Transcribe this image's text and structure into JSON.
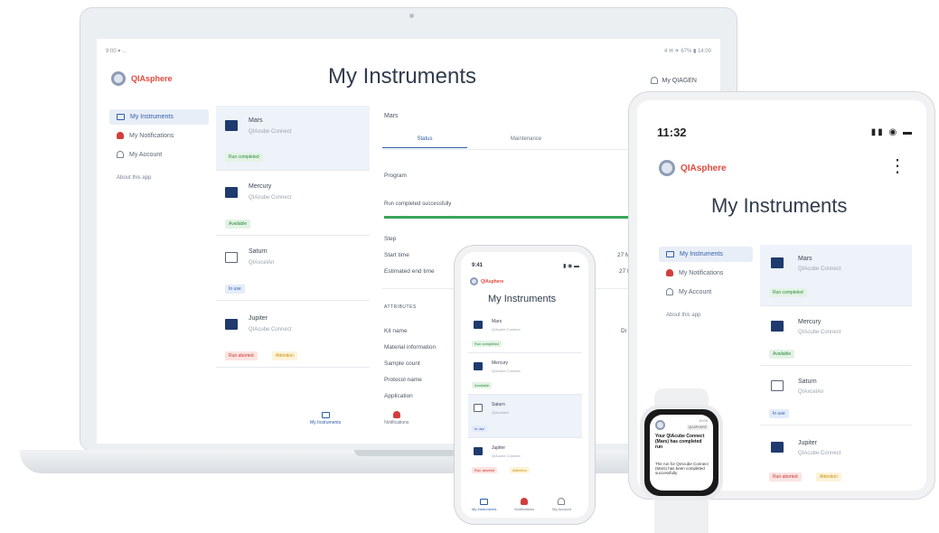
{
  "laptop": {
    "status_left": "9:00 ▾ ...",
    "status_right": "4 ✉ ✈ 67% ▮ 14:00",
    "brand": "QIAsphere",
    "title": "My Instruments",
    "account": "My QIAGEN",
    "sidebar": [
      {
        "label": "My Instruments"
      },
      {
        "label": "My Notifications"
      },
      {
        "label": "My Account"
      }
    ],
    "about": "About this app",
    "instruments": [
      {
        "name": "Mars",
        "sub": "QIAcube Connect",
        "badges": [
          {
            "label": "Run completed",
            "color": "green"
          }
        ]
      },
      {
        "name": "Mercury",
        "sub": "QIAcube Connect",
        "badges": [
          {
            "label": "Available",
            "color": "green"
          }
        ]
      },
      {
        "name": "Saturn",
        "sub": "QIAxcelAn",
        "badges": [
          {
            "label": "In use",
            "color": "blue"
          }
        ]
      },
      {
        "name": "Jupiter",
        "sub": "QIAcube Connect",
        "badges": [
          {
            "label": "Run aborted",
            "color": "red"
          },
          {
            "label": "Attention",
            "color": "yellow"
          }
        ]
      }
    ],
    "detail": {
      "title": "Mars",
      "tabs": [
        "Status",
        "Maintenance"
      ],
      "program_label": "Program",
      "run_status": "Run completed successfully",
      "progress": 1.0,
      "step": "Step",
      "start_time": "Start time",
      "start_value": "27 M",
      "est_end": "Estimated end time",
      "est_value": "27 M",
      "attributes": "ATTRIBUTES",
      "rows": [
        "Kit name",
        "Material information",
        "Sample count",
        "Protocol name",
        "Application"
      ],
      "kit_value": "Di"
    },
    "bottom_nav": [
      "My Instruments",
      "Notifications"
    ]
  },
  "tablet": {
    "time": "11:32",
    "brand": "QIAsphere",
    "menu": "⋮",
    "title": "My Instruments",
    "sidebar": [
      {
        "label": "My Instruments"
      },
      {
        "label": "My Notifications"
      },
      {
        "label": "My Account"
      }
    ],
    "about": "About this app",
    "instruments": [
      {
        "name": "Mars",
        "sub": "QIAcube Connect",
        "badges": [
          {
            "label": "Run completed",
            "color": "green"
          }
        ]
      },
      {
        "name": "Mercury",
        "sub": "QIAcube Connect",
        "badges": [
          {
            "label": "Available",
            "color": "green"
          }
        ]
      },
      {
        "name": "Saturn",
        "sub": "QIAxcelAn",
        "badges": [
          {
            "label": "In use",
            "color": "blue"
          }
        ]
      },
      {
        "name": "Jupiter",
        "sub": "QIAcube Connect",
        "badges": [
          {
            "label": "Run aborted",
            "color": "red"
          },
          {
            "label": "Attention",
            "color": "yellow"
          }
        ]
      }
    ]
  },
  "phone": {
    "time": "9:41",
    "brand": "QIAsphere",
    "title": "My Instruments",
    "instruments": [
      {
        "name": "Mars",
        "sub": "QIAcube Connect",
        "badges": [
          {
            "label": "Run completed",
            "color": "green"
          }
        ]
      },
      {
        "name": "Mercury",
        "sub": "QIAcube Connect",
        "badges": [
          {
            "label": "Available",
            "color": "green"
          }
        ]
      },
      {
        "name": "Saturn",
        "sub": "QIAxcelAn",
        "badges": [
          {
            "label": "In use",
            "color": "blue"
          }
        ]
      },
      {
        "name": "Jupiter",
        "sub": "QIAcube Connect",
        "badges": [
          {
            "label": "Run aborted",
            "color": "red"
          },
          {
            "label": "Attention",
            "color": "yellow"
          }
        ]
      }
    ],
    "bottom_nav": [
      "My Instruments",
      "Notifications",
      "My Account"
    ]
  },
  "watch": {
    "time": "10:09",
    "app": "QIASPHERE",
    "headline": "Your QIAcube Connect (Mars) has completed run",
    "body": "The run for QIAcube Connect (Mars) has been completed successfully"
  },
  "colors": {
    "brand_red": "#e2493d",
    "accent_blue": "#2f5ea8",
    "success_green": "#3aa55a",
    "navy": "#1f3a6e"
  }
}
